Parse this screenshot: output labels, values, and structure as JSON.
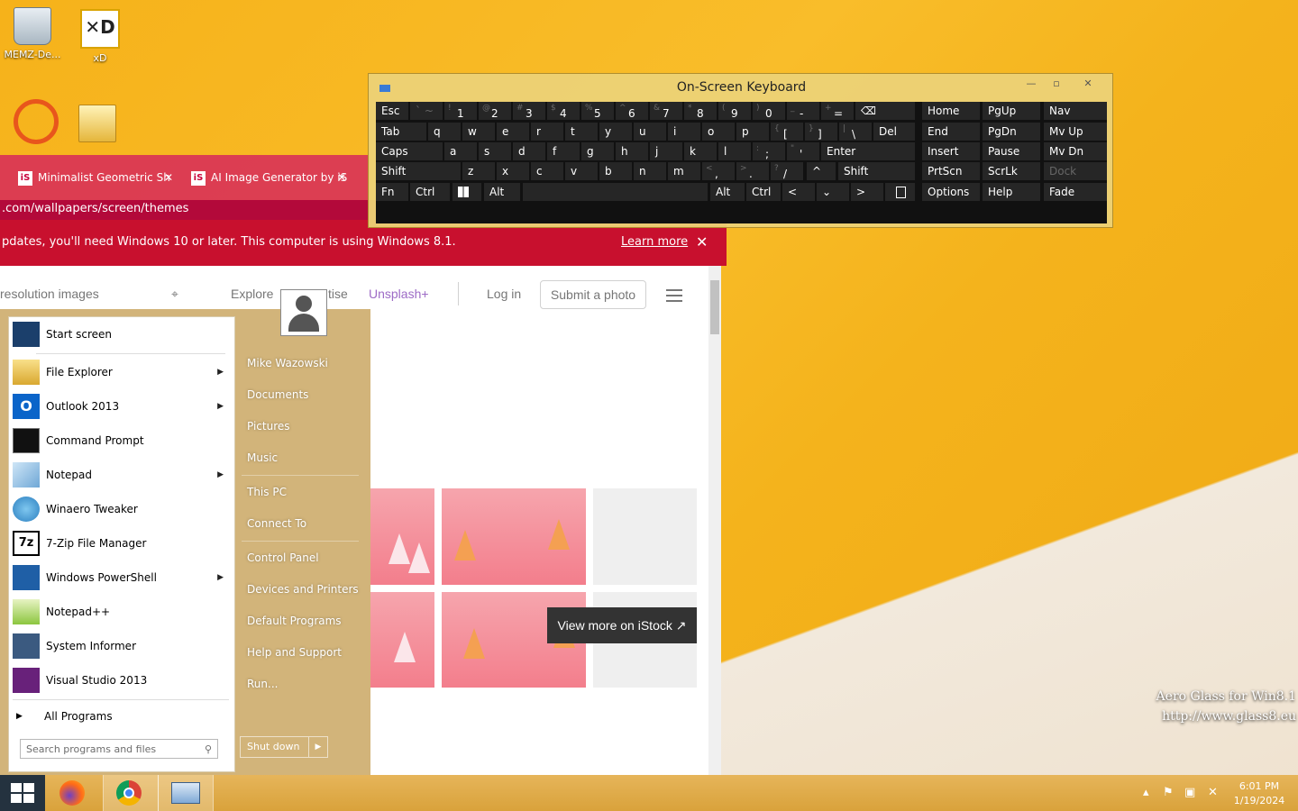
{
  "desktop": {
    "icons": [
      {
        "label": "MEMZ-De...",
        "icon": "recycle-bin-icon"
      },
      {
        "label": "xD",
        "icon": "xd-shortcut-icon"
      },
      {
        "label": "",
        "icon": "magnifier-shortcut-icon"
      },
      {
        "label": "",
        "icon": "folder-icon"
      }
    ],
    "watermark_line1": "Aero Glass for Win8.1",
    "watermark_line2": "http://www.glass8.eu"
  },
  "browser": {
    "tabs": [
      {
        "label": "Minimalist Geometric Sh",
        "favicon": "iS",
        "close": "✕"
      },
      {
        "label": "AI Image Generator by iS",
        "favicon": "iS",
        "close": "✕"
      }
    ],
    "url": ".com/wallpapers/screen/themes",
    "warning": {
      "text": "pdates, you'll need Windows 10 or later. This computer is using Windows 8.1.",
      "link": "Learn more",
      "close": "✕"
    },
    "page": {
      "search_placeholder": "resolution images",
      "nav": {
        "explore": "Explore",
        "advertise": "tise",
        "unsplash_plus": "Unsplash+",
        "login": "Log in",
        "submit": "Submit a photo"
      },
      "istock_button": "View more on iStock ↗",
      "accent": "#c8102e"
    }
  },
  "start_menu": {
    "programs": [
      {
        "label": "Start screen",
        "icon": "start-screen-icon",
        "submenu": false
      },
      {
        "label": "File Explorer",
        "icon": "file-explorer-icon",
        "submenu": true
      },
      {
        "label": "Outlook 2013",
        "icon": "outlook-icon",
        "submenu": true
      },
      {
        "label": "Command Prompt",
        "icon": "command-prompt-icon",
        "submenu": false
      },
      {
        "label": "Notepad",
        "icon": "notepad-icon",
        "submenu": true
      },
      {
        "label": "Winaero Tweaker",
        "icon": "winaero-tweaker-icon",
        "submenu": false
      },
      {
        "label": "7-Zip File Manager",
        "icon": "7zip-icon",
        "submenu": false
      },
      {
        "label": "Windows PowerShell",
        "icon": "powershell-icon",
        "submenu": true
      },
      {
        "label": "Notepad++",
        "icon": "notepadpp-icon",
        "submenu": false
      },
      {
        "label": "System Informer",
        "icon": "system-informer-icon",
        "submenu": false
      },
      {
        "label": "Visual Studio 2013",
        "icon": "visual-studio-icon",
        "submenu": false
      }
    ],
    "all_programs": "All Programs",
    "search_placeholder": "Search programs and files",
    "right": {
      "user": "Mike Wazowski",
      "documents": "Documents",
      "pictures": "Pictures",
      "music": "Music",
      "this_pc": "This PC",
      "connect_to": "Connect To",
      "control_panel": "Control Panel",
      "devices": "Devices and Printers",
      "default_programs": "Default Programs",
      "help": "Help and Support",
      "run": "Run..."
    },
    "shutdown": "Shut down"
  },
  "osk": {
    "title": "On-Screen Keyboard",
    "row1": {
      "esc": "Esc",
      "del_glyph": "⌫",
      "home": "Home",
      "pgup": "PgUp",
      "nav": "Nav"
    },
    "row2": {
      "tab": "Tab",
      "del": "Del",
      "end": "End",
      "pgdn": "PgDn",
      "mvup": "Mv Up"
    },
    "row3": {
      "caps": "Caps",
      "enter": "Enter",
      "insert": "Insert",
      "pause": "Pause",
      "mvdn": "Mv Dn"
    },
    "row4": {
      "shift": "Shift",
      "up": "^",
      "shift2": "Shift",
      "prtscn": "PrtScn",
      "scrlk": "ScrLk",
      "dock": "Dock"
    },
    "row5": {
      "fn": "Fn",
      "ctrl": "Ctrl",
      "alt": "Alt",
      "alt2": "Alt",
      "ctrl2": "Ctrl",
      "left": "<",
      "down": "⌄",
      "right": ">",
      "options": "Options",
      "help": "Help",
      "fade": "Fade"
    },
    "num_keys": [
      {
        "main": "1",
        "shift": "!"
      },
      {
        "main": "2",
        "shift": "@"
      },
      {
        "main": "3",
        "shift": "#"
      },
      {
        "main": "4",
        "shift": "$"
      },
      {
        "main": "5",
        "shift": "%"
      },
      {
        "main": "6",
        "shift": "^"
      },
      {
        "main": "7",
        "shift": "&"
      },
      {
        "main": "8",
        "shift": "*"
      },
      {
        "main": "9",
        "shift": "("
      },
      {
        "main": "0",
        "shift": ")"
      },
      {
        "main": "-",
        "shift": "_"
      },
      {
        "main": "=",
        "shift": "+"
      }
    ],
    "letters_row2": [
      "q",
      "w",
      "e",
      "r",
      "t",
      "y",
      "u",
      "i",
      "o",
      "p"
    ],
    "brackets": [
      {
        "main": "[",
        "shift": "{"
      },
      {
        "main": "]",
        "shift": "}"
      },
      {
        "main": "\\",
        "shift": "|"
      }
    ],
    "letters_row3": [
      "a",
      "s",
      "d",
      "f",
      "g",
      "h",
      "j",
      "k",
      "l"
    ],
    "punct3": [
      {
        "main": ";",
        "shift": ":"
      },
      {
        "main": "'",
        "shift": "\""
      }
    ],
    "letters_row4": [
      "z",
      "x",
      "c",
      "v",
      "b",
      "n",
      "m"
    ],
    "punct4": [
      {
        "main": ",",
        "shift": "<"
      },
      {
        "main": ".",
        "shift": ">"
      },
      {
        "main": "/",
        "shift": "?"
      }
    ]
  },
  "taskbar": {
    "time": "6:01 PM",
    "date": "1/19/2024",
    "apps": [
      "firefox-icon",
      "chrome-icon",
      "on-screen-keyboard-icon"
    ]
  }
}
